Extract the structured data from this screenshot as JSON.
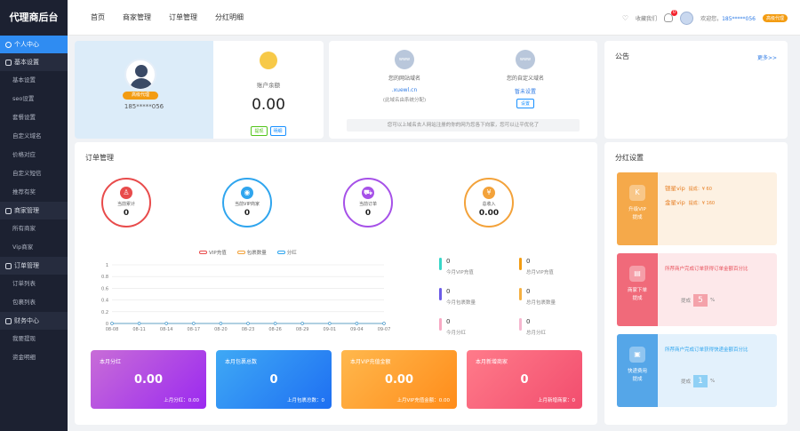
{
  "sidebar": {
    "brand": "代理商后台",
    "groups": [
      {
        "label": "个人中心",
        "active": true,
        "items": []
      },
      {
        "label": "基本设置",
        "active": false,
        "items": [
          "基本设置",
          "seo设置",
          "套餐设置",
          "自定义域名",
          "价格对应",
          "自定义短信",
          "推荐有奖"
        ]
      },
      {
        "label": "商家管理",
        "active": false,
        "items": [
          "所有商家",
          "Vip商家"
        ]
      },
      {
        "label": "订单管理",
        "active": false,
        "items": [
          "订单列表",
          "包裹列表"
        ]
      },
      {
        "label": "财务中心",
        "active": false,
        "items": [
          "我要提现",
          "资金明细"
        ]
      }
    ]
  },
  "header": {
    "nav": [
      "首页",
      "商家管理",
      "订单管理",
      "分红明细"
    ],
    "favorite": "收藏我们",
    "bell_count": "0",
    "welcome": "欢迎您，",
    "phone": "185*****056",
    "vip_tag": "高级代理"
  },
  "profile": {
    "vip_badge": "高级代理",
    "phone": "185*****056"
  },
  "balance": {
    "label": "账户余额",
    "value": "0.00",
    "btn_withdraw": "提现",
    "btn_detail": "明细"
  },
  "domains": {
    "site_label": "您的网站域名",
    "site_value": ".xuewl.cn",
    "site_note": "(此域名由系统分配)",
    "custom_label": "您的自定义域名",
    "custom_value": "暂未设置",
    "custom_btn": "设置",
    "tip": "您可以上域名去人网站注册的你的网为您各下向家，您可以让平优化了"
  },
  "notice": {
    "title": "公告",
    "more": "更多>>"
  },
  "orders": {
    "title": "订单管理",
    "circles": [
      {
        "label": "当前累计",
        "value": "0",
        "color": "#e84b4b",
        "icon": "user-icon"
      },
      {
        "label": "当前VIP商家",
        "value": "0",
        "color": "#2fa5ee",
        "icon": "drop-icon"
      },
      {
        "label": "当前订单",
        "value": "0",
        "color": "#a651e8",
        "icon": "cart-icon"
      },
      {
        "label": "总收入",
        "value": "0.00",
        "color": "#f3a23a",
        "icon": "yen-icon"
      }
    ],
    "legend": [
      "VIP充值",
      "包裹数量",
      "分红"
    ],
    "legend_colors": [
      "#e84b4b",
      "#f3a23a",
      "#2fa5ee"
    ],
    "stats": [
      {
        "value": "0",
        "label": "今月VIP充值",
        "color": "#38d6c8"
      },
      {
        "value": "0",
        "label": "总月VIP充值",
        "color": "#f39c12"
      },
      {
        "value": "0",
        "label": "今月包裹数量",
        "color": "#6c5ce7"
      },
      {
        "value": "0",
        "label": "总月包裹数量",
        "color": "#f5b041"
      },
      {
        "value": "0",
        "label": "今月分红",
        "color": "#f7a9c4"
      },
      {
        "value": "0",
        "label": "总月分红",
        "color": "#f5b7d0"
      }
    ],
    "tiles": [
      {
        "title": "本月分红",
        "value": "0.00",
        "bottom": "上月分红：0.00",
        "grad": "linear-gradient(135deg,#c86dd7,#9b29f0)"
      },
      {
        "title": "本月包裹总数",
        "value": "0",
        "bottom": "上月包裹总数：0",
        "grad": "linear-gradient(135deg,#3fa9f5,#1e6ff2)"
      },
      {
        "title": "本月VIP充值金额",
        "value": "0.00",
        "bottom": "上月VIP充值金额：0.00",
        "grad": "linear-gradient(135deg,#ffb84d,#ff8c1a)"
      },
      {
        "title": "本月新增商家",
        "value": "0",
        "bottom": "上月新增商家：0",
        "grad": "linear-gradient(135deg,#ff7b8a,#f24d6e)"
      }
    ]
  },
  "chart_data": {
    "type": "line",
    "x": [
      "08-08",
      "08-11",
      "08-14",
      "08-17",
      "08-20",
      "08-23",
      "08-26",
      "08-29",
      "09-01",
      "09-04",
      "09-07"
    ],
    "ylim": [
      0,
      1
    ],
    "yticks": [
      "0",
      "0.2",
      "0.4",
      "0.6",
      "0.8",
      "1"
    ],
    "series": [
      {
        "name": "VIP充值",
        "values": [
          0,
          0,
          0,
          0,
          0,
          0,
          0,
          0,
          0,
          0,
          0
        ],
        "color": "#e84b4b"
      },
      {
        "name": "包裹数量",
        "values": [
          0,
          0,
          0,
          0,
          0,
          0,
          0,
          0,
          0,
          0,
          0
        ],
        "color": "#f3a23a"
      },
      {
        "name": "分红",
        "values": [
          0,
          0,
          0,
          0,
          0,
          0,
          0,
          0,
          0,
          0,
          0
        ],
        "color": "#2fa5ee"
      }
    ],
    "grid": true
  },
  "commission": {
    "title": "分红设置",
    "panel1": {
      "left_label": "升级VIP\n提成",
      "row1_name": "银星vip",
      "row1_rate": "提成：¥ 60",
      "row2_name": "金星vip",
      "row2_rate": "提成：¥ 160"
    },
    "panel2": {
      "left_label": "商家下单\n提成",
      "text": "所荐商户完成订单获得订单金额百分比",
      "label": "提成",
      "value": "5",
      "unit": "%"
    },
    "panel3": {
      "left_label": "快递费用\n提成",
      "text": "所荐商户完成订单获得快递金额百分比",
      "label": "提成",
      "value": "1",
      "unit": "%"
    }
  }
}
